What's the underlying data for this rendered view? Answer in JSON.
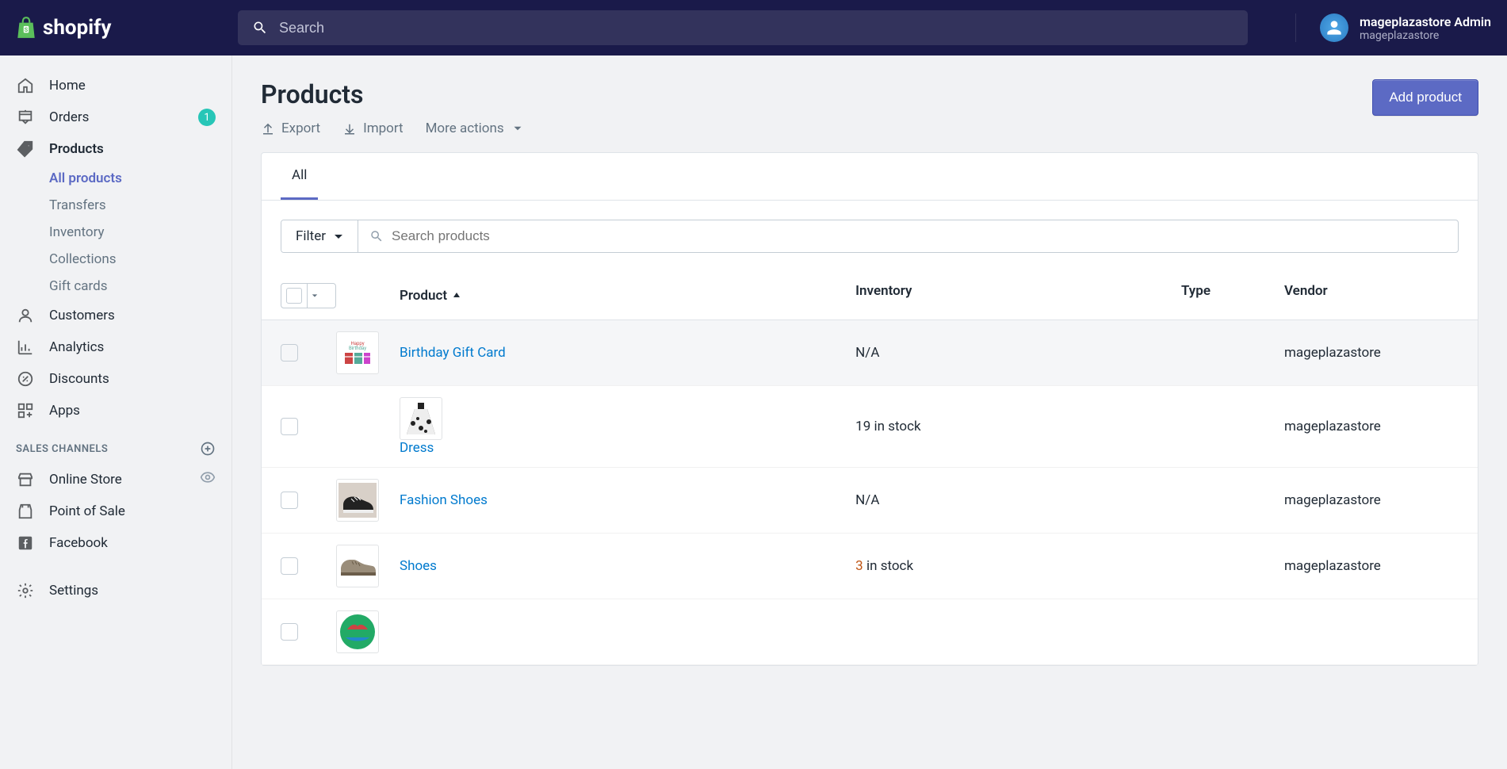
{
  "header": {
    "brand": "shopify",
    "search_placeholder": "Search",
    "user_name": "mageplazastore Admin",
    "store_name": "mageplazastore"
  },
  "sidebar": {
    "home": "Home",
    "orders": "Orders",
    "orders_badge": "1",
    "products": "Products",
    "sub_all": "All products",
    "sub_transfers": "Transfers",
    "sub_inventory": "Inventory",
    "sub_collections": "Collections",
    "sub_gift": "Gift cards",
    "customers": "Customers",
    "analytics": "Analytics",
    "discounts": "Discounts",
    "apps": "Apps",
    "section_channels": "SALES CHANNELS",
    "online_store": "Online Store",
    "pos": "Point of Sale",
    "facebook": "Facebook",
    "settings": "Settings"
  },
  "page": {
    "title": "Products",
    "export": "Export",
    "import": "Import",
    "more": "More actions",
    "add_btn": "Add product"
  },
  "table": {
    "tab_all": "All",
    "filter": "Filter",
    "search_placeholder": "Search products",
    "col_product": "Product",
    "col_inventory": "Inventory",
    "col_type": "Type",
    "col_vendor": "Vendor",
    "rows": [
      {
        "name": "Birthday Gift Card",
        "inventory": "N/A",
        "inv_warn": false,
        "type": "",
        "vendor": "mageplazastore",
        "highlight": false,
        "hov": true,
        "thumb": "gift"
      },
      {
        "name": "Dress",
        "inventory": "19 in stock",
        "inv_warn": false,
        "type": "",
        "vendor": "mageplazastore",
        "highlight": true,
        "hov": false,
        "thumb": "dress"
      },
      {
        "name": "Fashion Shoes",
        "inventory": "N/A",
        "inv_warn": false,
        "type": "",
        "vendor": "mageplazastore",
        "highlight": false,
        "hov": false,
        "thumb": "sneaker"
      },
      {
        "name": "Shoes",
        "inventory": " in stock",
        "inv_prefix": "3",
        "inv_warn": true,
        "type": "",
        "vendor": "mageplazastore",
        "highlight": false,
        "hov": false,
        "thumb": "shoe"
      },
      {
        "name": "",
        "inventory": "",
        "inv_warn": false,
        "type": "",
        "vendor": "",
        "highlight": false,
        "hov": false,
        "thumb": "circle"
      }
    ]
  }
}
